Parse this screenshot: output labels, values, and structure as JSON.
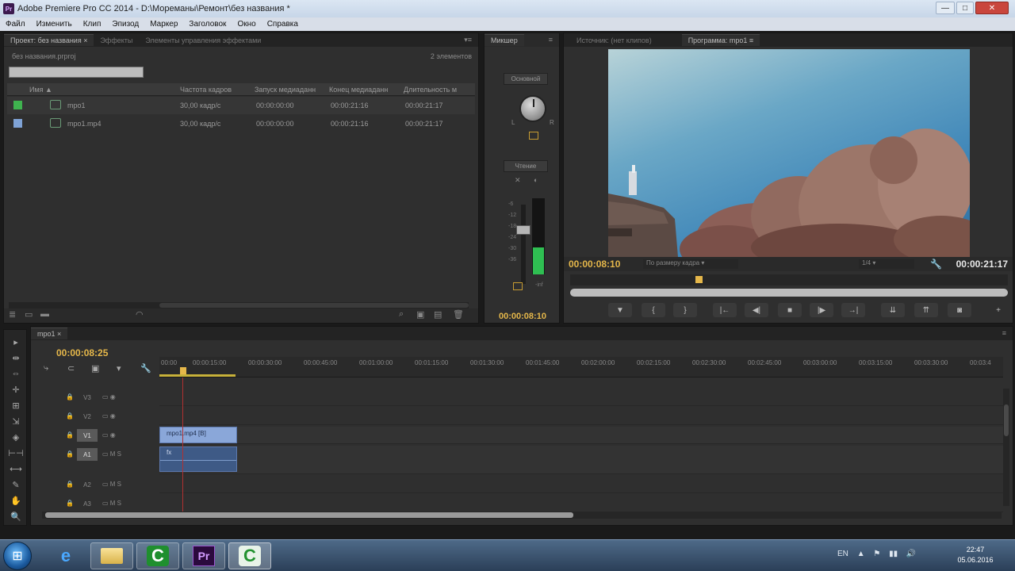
{
  "window": {
    "title": "Adobe Premiere Pro CC 2014 - D:\\Мореманы\\Ремонт\\без названия *",
    "app_icon": "Pr",
    "minimize": "—",
    "maximize": "□",
    "close": "✕"
  },
  "menu": [
    "Файл",
    "Изменить",
    "Клип",
    "Эпизод",
    "Маркер",
    "Заголовок",
    "Окно",
    "Справка"
  ],
  "project": {
    "tabs": [
      "Проект: без названия ×",
      "Эффекты",
      "Элементы управления эффектами"
    ],
    "panel_menu": "▾≡",
    "path": "без названия.prproj",
    "items_count": "2 элементов",
    "search_placeholder": "",
    "search_icon": "search-icon",
    "columns": [
      "Имя ▲",
      "Частота кадров",
      "Запуск медиаданн",
      "Конец медиаданн",
      "Длительность м"
    ],
    "rows": [
      {
        "color": "#3fb34f",
        "name": "mpo1",
        "fps": "30,00 кадр/с",
        "start": "00:00:00:00",
        "end": "00:00:21:16",
        "duration": "00:00:21:17"
      },
      {
        "color": "#7fa3d6",
        "name": "mpo1.mp4",
        "fps": "30,00 кадр/с",
        "start": "00:00:00:00",
        "end": "00:00:21:16",
        "duration": "00:00:21:17"
      }
    ],
    "toolbar_icons": [
      "≣",
      "▭",
      "▬",
      "◠",
      "⌕",
      "▣",
      "▤",
      "🗑"
    ]
  },
  "mixer": {
    "tab": "Микшер",
    "panel_menu": "≡",
    "main_label": "Основной",
    "read_label": "Чтение",
    "pan_left": "L",
    "pan_right": "R",
    "db_labels": [
      "-6",
      "-12",
      "-18",
      "-24",
      "-30",
      "-36"
    ],
    "db_bottom": "-inf",
    "meter_level": 0.35,
    "time": "00:00:08:10"
  },
  "program": {
    "tabs": [
      "Источник: (нет клипов)",
      "Программа: mpo1 ≡"
    ],
    "current_time": "00:00:08:10",
    "fit": "По размеру кадра",
    "resolution": "1/4",
    "duration": "00:00:21:17",
    "transport": [
      "▼",
      "{",
      "}",
      "|←",
      "◀|",
      "■",
      "|▶",
      "→|",
      "⇊",
      "⇈",
      "◙",
      "+"
    ]
  },
  "tools": [
    "▸",
    "⇹",
    "⇔",
    "✛",
    "⊞",
    "⇲",
    "◈",
    "⊢⊣",
    "⟷",
    "✎",
    "✋",
    "🔍"
  ],
  "timeline": {
    "tab": "mpo1 ×",
    "panel_menu": "≡",
    "timecode": "00:00:08:25",
    "tool_icons": [
      "⤷",
      "⊂",
      "▣",
      "▾",
      "🔧"
    ],
    "ruler_labels": [
      "00:00",
      "00:00:15:00",
      "00:00:30:00",
      "00:00:45:00",
      "00:01:00:00",
      "00:01:15:00",
      "00:01:30:00",
      "00:01:45:00",
      "00:02:00:00",
      "00:02:15:00",
      "00:02:30:00",
      "00:02:45:00",
      "00:03:00:00",
      "00:03:15:00",
      "00:03:30:00",
      "00:03:4"
    ],
    "tracks": [
      {
        "name": "V3",
        "extra": "▭ ◉",
        "on": false
      },
      {
        "name": "V2",
        "extra": "▭ ◉",
        "on": false
      },
      {
        "name": "V1",
        "extra": "▭ ◉",
        "on": true
      },
      {
        "name": "A1",
        "extra": "▭ M S",
        "on": true
      },
      {
        "name": "A2",
        "extra": "▭ M S",
        "on": false
      },
      {
        "name": "A3",
        "extra": "▭ M S",
        "on": false
      }
    ],
    "clip_video": "mpo1.mp4 [В]",
    "clip_audio_fx": "fx"
  },
  "taskbar": {
    "start_icon": "⊞",
    "ie_icon": "e",
    "camtasia_icon": "C",
    "premiere_icon": "Pr",
    "tray": [
      "EN",
      "▲",
      "⚑",
      "▮▮",
      "🔊"
    ],
    "time": "22:47",
    "date": "05.06.2016"
  }
}
